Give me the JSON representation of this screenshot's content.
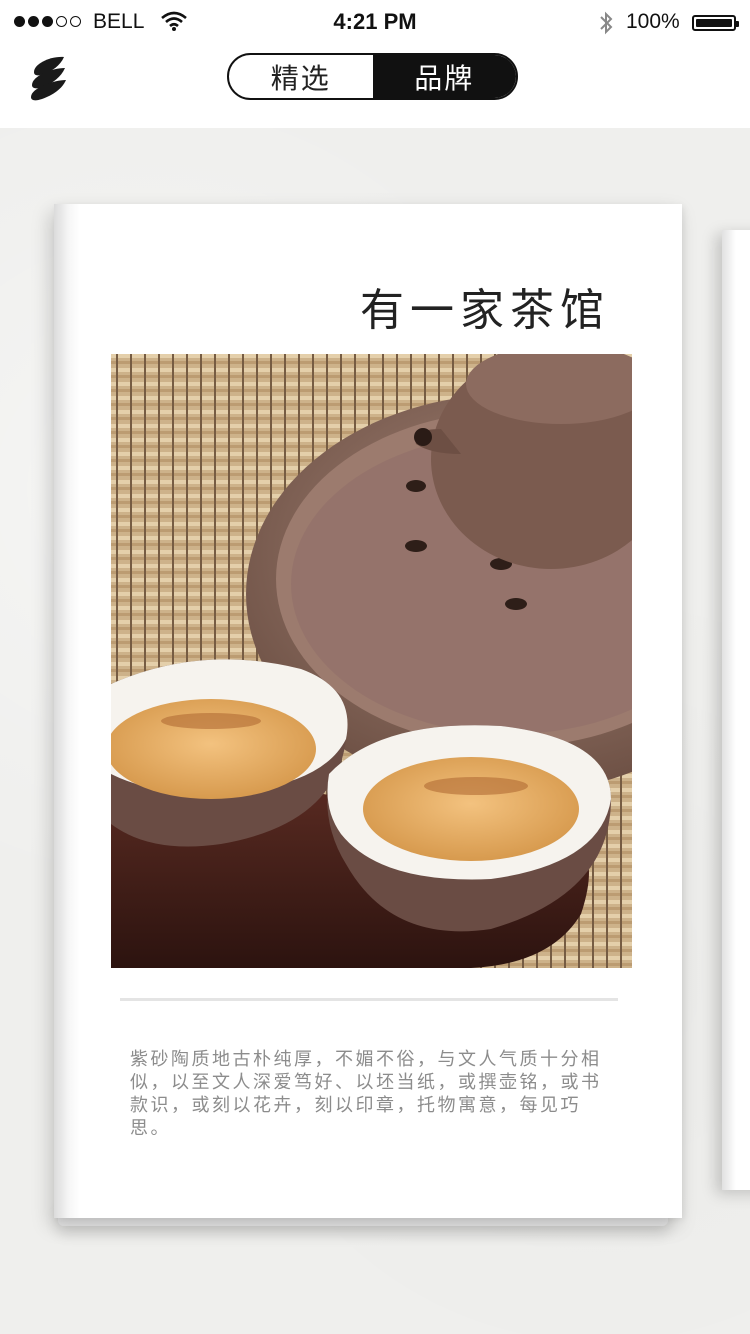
{
  "status_bar": {
    "carrier": "BELL",
    "time": "4:21 PM",
    "battery": "100%",
    "signal_bars_filled": 3,
    "signal_bars_total": 5
  },
  "nav": {
    "tabs": [
      {
        "label": "精选",
        "active": false
      },
      {
        "label": "品牌",
        "active": true
      }
    ]
  },
  "card": {
    "title": "有一家茶馆",
    "photo_icon": "teapot-and-tea-cups-photo",
    "description": "紫砂陶质地古朴纯厚，不媚不俗，与文人气质十分相似，以至文人深爱笃好、以坯当纸，或撰壶铭，或书款识，或刻以花卉，刻以印章，托物寓意，每见巧思。"
  },
  "colors": {
    "accent": "#111111",
    "background": "#efeeec",
    "text_muted": "#8c8c8c"
  }
}
